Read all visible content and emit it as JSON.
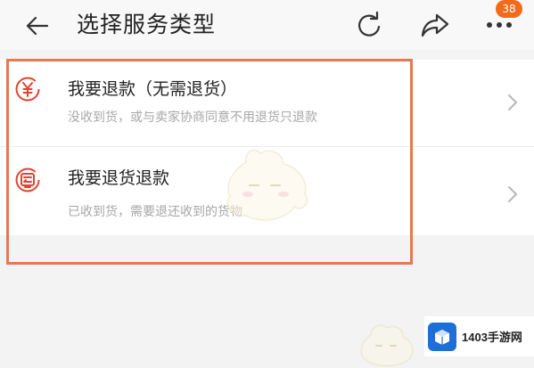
{
  "header": {
    "title": "选择服务类型",
    "back_icon": "arrow-left-icon",
    "refresh_icon": "refresh-icon",
    "share_icon": "share-icon",
    "more_icon": "more-dots-icon",
    "badge_count": "38"
  },
  "options": [
    {
      "title": "我要退款（无需退货）",
      "description": "没收到货，或与卖家协商同意不用退货只退款",
      "icon": "yuan-refund-icon"
    },
    {
      "title": "我要退货退款",
      "description": "已收到货，需要退还收到的货物",
      "icon": "return-goods-icon"
    }
  ],
  "watermark": {
    "site_name": "1403手游网"
  },
  "colors": {
    "accent_red": "#e0432f",
    "highlight_border": "#e37a52",
    "badge": "#f26a1b",
    "watermark_blue": "#1c6fd8"
  }
}
